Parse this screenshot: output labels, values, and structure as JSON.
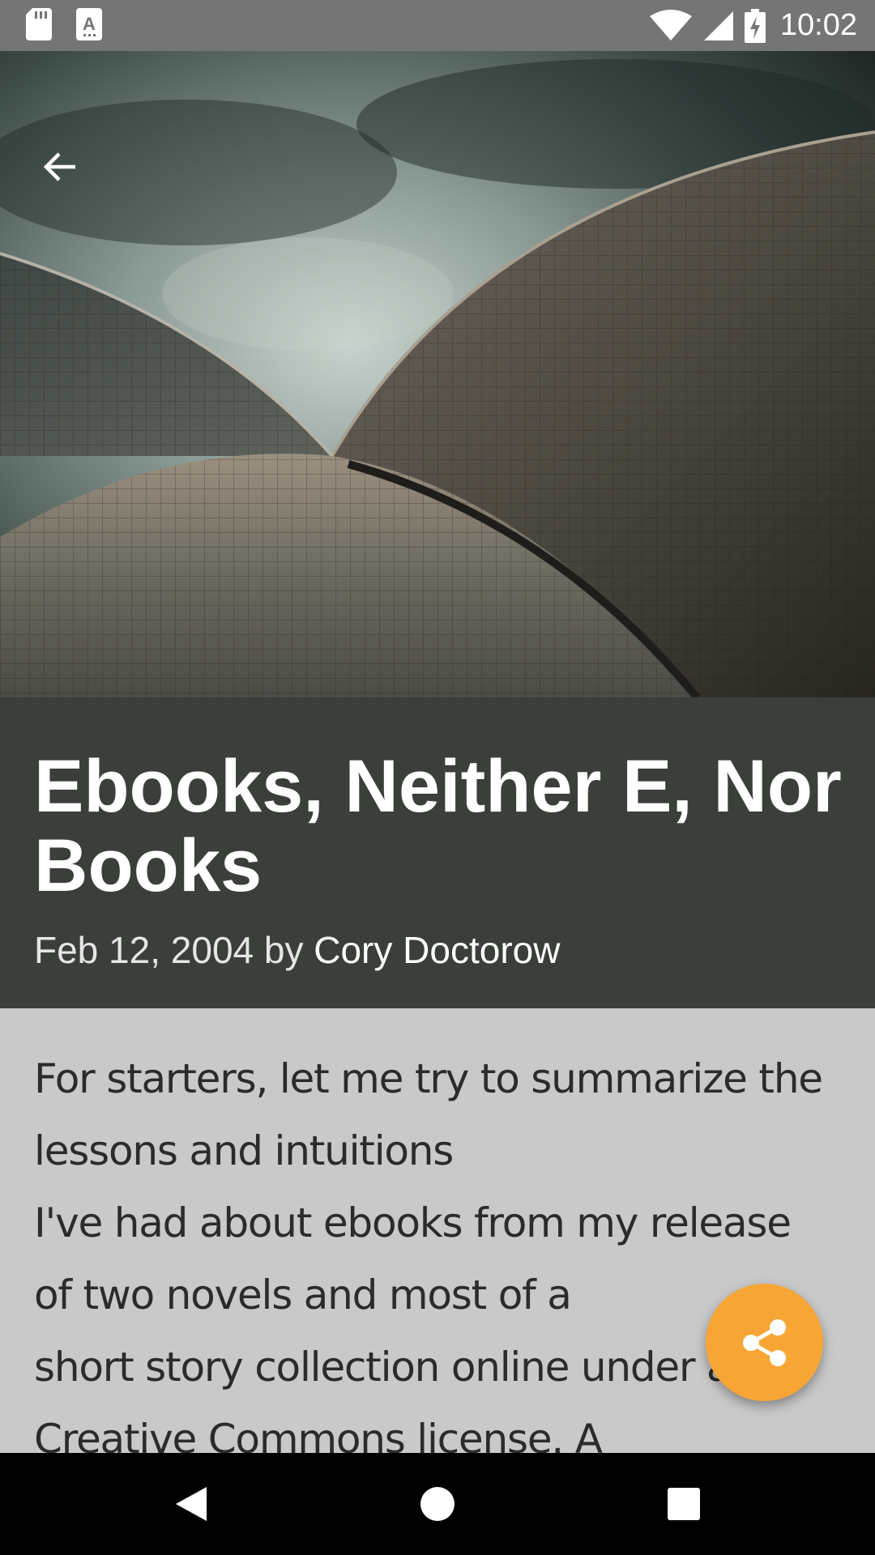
{
  "status_bar": {
    "time": "10:02",
    "left_icons": [
      "sd-card-icon",
      "font-a-icon"
    ],
    "right_icons": [
      "wifi-icon",
      "cell-signal-icon",
      "battery-charging-icon"
    ]
  },
  "hero": {
    "image": "sydney-opera-house-roof-shells",
    "back_icon": "arrow-back-icon"
  },
  "article": {
    "title": "Ebooks, Neither E, Nor Books",
    "date_by": "Feb 12, 2004 by ",
    "author": "Cory Doctorow",
    "body_lines": [
      "For starters, let me try to summarize the",
      "lessons and intuitions",
      "I've had about ebooks from my release",
      "of two novels and most of a",
      "short story collection online under a",
      "Creative Commons license. A"
    ]
  },
  "fab": {
    "icon": "share-icon",
    "color": "#f7a636"
  },
  "nav_bar": {
    "buttons": [
      "back-triangle-icon",
      "home-circle-icon",
      "recents-square-icon"
    ]
  },
  "colors": {
    "status_bar": "#757575",
    "title_band": "#3b3f3a",
    "body_bg": "#c9c9c9",
    "accent": "#f7a636"
  }
}
